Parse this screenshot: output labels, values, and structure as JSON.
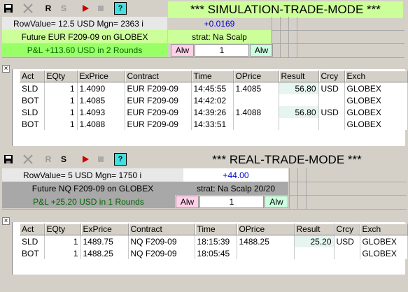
{
  "toolbar_icons": [
    "save-icon",
    "close-icon",
    "r-icon",
    "s-icon",
    "play-icon",
    "stop-icon",
    "help-icon"
  ],
  "sim": {
    "toolbar": {
      "r_label": "R",
      "s_label": "S",
      "help_label": "?"
    },
    "title": "*** SIMULATION-TRADE-MODE ***",
    "row_value": "RowValue= 12.5 USD Mgn= 2363 i",
    "change": "+0.0169",
    "contract_line": "Future EUR  F209-09 on GLOBEX",
    "strat": "strat: Na Scalp",
    "pnl": "P&L +113.60 USD in 2 Rounds",
    "alw_left": "Alw",
    "qty": "1",
    "alw_right": "Alw",
    "columns": [
      "Act",
      "EQty",
      "ExPrice",
      "Contract",
      "Time",
      "OPrice",
      "Result",
      "Crcy",
      "Exch"
    ],
    "rows": [
      {
        "act": "SLD",
        "eqty": "1",
        "exprice": "1.4090",
        "contract": "EUR  F209-09",
        "time": "14:45:55",
        "oprice": "1.4085",
        "result": "56.80",
        "crcy": "USD",
        "exch": "GLOBEX"
      },
      {
        "act": "BOT",
        "eqty": "1",
        "exprice": "1.4085",
        "contract": "EUR  F209-09",
        "time": "14:42:02",
        "oprice": "",
        "result": "",
        "crcy": "",
        "exch": "GLOBEX"
      },
      {
        "act": "SLD",
        "eqty": "1",
        "exprice": "1.4093",
        "contract": "EUR  F209-09",
        "time": "14:39:26",
        "oprice": "1.4088",
        "result": "56.80",
        "crcy": "USD",
        "exch": "GLOBEX"
      },
      {
        "act": "BOT",
        "eqty": "1",
        "exprice": "1.4088",
        "contract": "EUR  F209-09",
        "time": "14:33:51",
        "oprice": "",
        "result": "",
        "crcy": "",
        "exch": "GLOBEX"
      }
    ]
  },
  "real": {
    "toolbar": {
      "r_label": "R",
      "s_label": "S",
      "help_label": "?"
    },
    "title": "*** REAL-TRADE-MODE ***",
    "row_value": "RowValue= 5 USD Mgn= 1750 i",
    "change": "+44.00",
    "contract_line": "Future NQ  F209-09 on GLOBEX",
    "strat": "strat: Na Scalp 20/20",
    "pnl": "P&L +25.20 USD in 1 Rounds",
    "alw_left": "Alw",
    "qty": "1",
    "alw_right": "Alw",
    "columns": [
      "Act",
      "EQty",
      "ExPrice",
      "Contract",
      "Time",
      "OPrice",
      "Result",
      "Crcy",
      "Exch"
    ],
    "rows": [
      {
        "act": "SLD",
        "eqty": "1",
        "exprice": "1489.75",
        "contract": "NQ  F209-09",
        "time": "18:15:39",
        "oprice": "1488.25",
        "result": "25.20",
        "crcy": "USD",
        "exch": "GLOBEX"
      },
      {
        "act": "BOT",
        "eqty": "1",
        "exprice": "1488.25",
        "contract": "NQ  F209-09",
        "time": "18:05:45",
        "oprice": "",
        "result": "",
        "crcy": "",
        "exch": "GLOBEX"
      }
    ]
  },
  "colors": {
    "sim_green": "#ccff99",
    "sim_pnl": "#99ff66",
    "real_gray": "#a8a8a8",
    "alw_pink": "#ffd0e8",
    "alw_green": "#ccffe0",
    "change_blue": "#0000cc"
  }
}
